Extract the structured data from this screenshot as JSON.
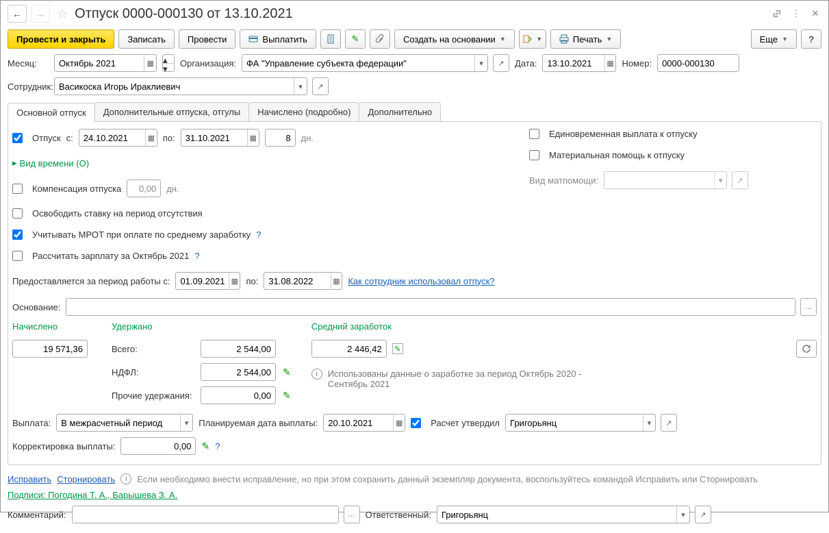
{
  "header": {
    "title": "Отпуск 0000-000130 от 13.10.2021"
  },
  "toolbar": {
    "post_close": "Провести и закрыть",
    "save": "Записать",
    "post": "Провести",
    "pay": "Выплатить",
    "create_based": "Создать на основании",
    "print": "Печать",
    "more": "Еще"
  },
  "fields": {
    "month_lbl": "Месяц:",
    "month_val": "Октябрь 2021",
    "org_lbl": "Организация:",
    "org_val": "ФА \"Управление субъекта федерации\"",
    "date_lbl": "Дата:",
    "date_val": "13.10.2021",
    "number_lbl": "Номер:",
    "number_val": "0000-000130",
    "employee_lbl": "Сотрудник:",
    "employee_val": "Васикоска Игорь Ираклиевич"
  },
  "tabs": {
    "t1": "Основной отпуск",
    "t2": "Дополнительные отпуска, отгулы",
    "t3": "Начислено (подробно)",
    "t4": "Дополнительно"
  },
  "main_tab": {
    "vacation_chk": "Отпуск",
    "from_lbl": "с:",
    "from_val": "24.10.2021",
    "to_lbl": "по:",
    "to_val": "31.10.2021",
    "days_val": "8",
    "days_lbl": "дн.",
    "lump_sum": "Единовременная выплата к отпуску",
    "material_help": "Материальная помощь к отпуску",
    "help_type_lbl": "Вид матпомощи:",
    "time_type": "Вид времени (О)",
    "compensation": "Компенсация отпуска",
    "comp_val": "0,00",
    "comp_days": "дн.",
    "free_rate": "Освободить ставку на период отсутствия",
    "mrot": "Учитывать МРОТ при оплате по среднему заработку",
    "calc_salary": "Рассчитать зарплату за Октябрь 2021",
    "period_lbl": "Предоставляется за период работы с:",
    "period_from": "01.09.2021",
    "period_to_lbl": "по:",
    "period_to": "31.08.2022",
    "usage_link": "Как сотрудник использовал отпуск?",
    "basis_lbl": "Основание:"
  },
  "summary": {
    "accrued_lbl": "Начислено",
    "accrued_val": "19 571,36",
    "withheld_lbl": "Удержано",
    "total_lbl": "Всего:",
    "total_val": "2 544,00",
    "ndfl_lbl": "НДФЛ:",
    "ndfl_val": "2 544,00",
    "other_lbl": "Прочие удержания:",
    "other_val": "0,00",
    "avg_lbl": "Средний заработок",
    "avg_val": "2 446,42",
    "info_text": "Использованы данные о заработке за период Октябрь 2020 - Сентябрь 2021"
  },
  "payment": {
    "pay_lbl": "Выплата:",
    "pay_val": "В межрасчетный период",
    "plan_date_lbl": "Планируемая дата выплаты:",
    "plan_date_val": "20.10.2021",
    "approved_lbl": "Расчет утвердил",
    "approved_val": "Григорьянц",
    "correction_lbl": "Корректировка выплаты:",
    "correction_val": "0,00"
  },
  "footer": {
    "correct": "Исправить",
    "reverse": "Сторнировать",
    "info": "Если необходимо внести исправление, но при этом сохранить данный экземпляр документа, воспользуйтесь командой Исправить или Сторнировать",
    "signatures": "Подписи: Погодина Т. А., Барышева З. А.",
    "comment_lbl": "Комментарий:",
    "responsible_lbl": "Ответственный:",
    "responsible_val": "Григорьянц"
  }
}
